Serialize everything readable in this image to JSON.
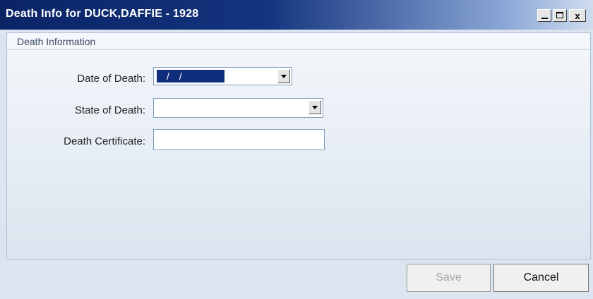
{
  "window": {
    "title": "Death Info for DUCK,DAFFIE - 1928",
    "controls": {
      "minimize": "_",
      "maximize": "□",
      "close": "x"
    }
  },
  "panel": {
    "title": "Death Information"
  },
  "form": {
    "date_of_death": {
      "label": "Date of Death:",
      "value": "/ /"
    },
    "state_of_death": {
      "label": "State of Death:",
      "value": ""
    },
    "death_certificate": {
      "label": "Death Certificate:",
      "value": ""
    }
  },
  "buttons": {
    "save": "Save",
    "cancel": "Cancel"
  },
  "icons": {
    "date_dropdown": "chevron-down-icon",
    "state_dropdown": "chevron-down-icon"
  }
}
